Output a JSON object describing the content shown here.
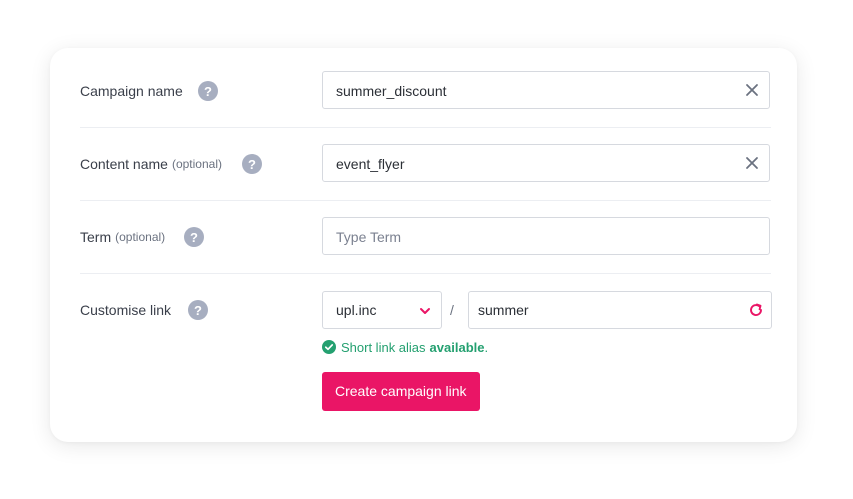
{
  "form": {
    "campaign": {
      "label": "Campaign name",
      "value": "summer_discount"
    },
    "content": {
      "label": "Content name",
      "optional": "(optional)",
      "value": "event_flyer"
    },
    "term": {
      "label": "Term",
      "optional": "(optional)",
      "placeholder": "Type Term",
      "value": ""
    },
    "customise": {
      "label": "Customise link",
      "domain": "upl.inc",
      "separator": "/",
      "alias": "summer",
      "status_prefix": "Short link alias",
      "status_word": "available",
      "status_suffix": "."
    },
    "help_glyph": "?",
    "submit_label": "Create campaign link"
  },
  "colors": {
    "accent": "#ea1566",
    "success": "#24a070",
    "help_badge": "#a7aec0"
  }
}
